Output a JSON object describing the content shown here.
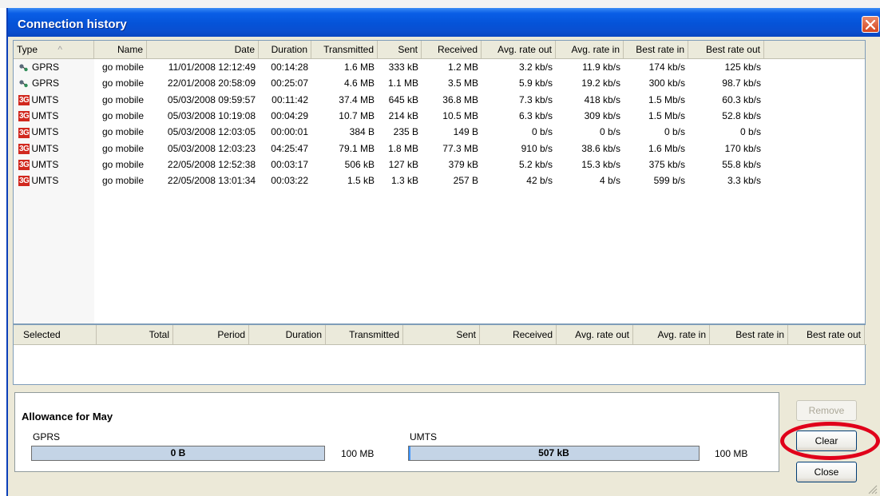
{
  "window": {
    "title": "Connection history"
  },
  "history": {
    "columns": [
      "Type",
      "Name",
      "Date",
      "Duration",
      "Transmitted",
      "Sent",
      "Received",
      "Avg. rate out",
      "Avg. rate in",
      "Best rate in",
      "Best rate out"
    ],
    "sort_indicator": "^",
    "rows": [
      {
        "type": "GPRS",
        "icon": "gprs-icon",
        "name": "go mobile",
        "date": "11/01/2008 12:12:49",
        "duration": "00:14:28",
        "transmitted": "1.6 MB",
        "sent": "333 kB",
        "received": "1.2 MB",
        "avg_out": "3.2 kb/s",
        "avg_in": "11.9 kb/s",
        "best_in": "174 kb/s",
        "best_out": "125 kb/s"
      },
      {
        "type": "GPRS",
        "icon": "gprs-icon",
        "name": "go mobile",
        "date": "22/01/2008 20:58:09",
        "duration": "00:25:07",
        "transmitted": "4.6 MB",
        "sent": "1.1 MB",
        "received": "3.5 MB",
        "avg_out": "5.9 kb/s",
        "avg_in": "19.2 kb/s",
        "best_in": "300 kb/s",
        "best_out": "98.7 kb/s"
      },
      {
        "type": "UMTS",
        "icon": "3g-icon",
        "name": "go mobile",
        "date": "05/03/2008 09:59:57",
        "duration": "00:11:42",
        "transmitted": "37.4 MB",
        "sent": "645 kB",
        "received": "36.8 MB",
        "avg_out": "7.3 kb/s",
        "avg_in": "418 kb/s",
        "best_in": "1.5 Mb/s",
        "best_out": "60.3 kb/s"
      },
      {
        "type": "UMTS",
        "icon": "3g-icon",
        "name": "go mobile",
        "date": "05/03/2008 10:19:08",
        "duration": "00:04:29",
        "transmitted": "10.7 MB",
        "sent": "214 kB",
        "received": "10.5 MB",
        "avg_out": "6.3 kb/s",
        "avg_in": "309 kb/s",
        "best_in": "1.5 Mb/s",
        "best_out": "52.8 kb/s"
      },
      {
        "type": "UMTS",
        "icon": "3g-icon",
        "name": "go mobile",
        "date": "05/03/2008 12:03:05",
        "duration": "00:00:01",
        "transmitted": "384 B",
        "sent": "235 B",
        "received": "149 B",
        "avg_out": "0 b/s",
        "avg_in": "0 b/s",
        "best_in": "0 b/s",
        "best_out": "0 b/s"
      },
      {
        "type": "UMTS",
        "icon": "3g-icon",
        "name": "go mobile",
        "date": "05/03/2008 12:03:23",
        "duration": "04:25:47",
        "transmitted": "79.1 MB",
        "sent": "1.8 MB",
        "received": "77.3 MB",
        "avg_out": "910 b/s",
        "avg_in": "38.6 kb/s",
        "best_in": "1.6 Mb/s",
        "best_out": "170 kb/s"
      },
      {
        "type": "UMTS",
        "icon": "3g-icon",
        "name": "go mobile",
        "date": "22/05/2008 12:52:38",
        "duration": "00:03:17",
        "transmitted": "506 kB",
        "sent": "127 kB",
        "received": "379 kB",
        "avg_out": "5.2 kb/s",
        "avg_in": "15.3 kb/s",
        "best_in": "375 kb/s",
        "best_out": "55.8 kb/s"
      },
      {
        "type": "UMTS",
        "icon": "3g-icon",
        "name": "go mobile",
        "date": "22/05/2008 13:01:34",
        "duration": "00:03:22",
        "transmitted": "1.5 kB",
        "sent": "1.3 kB",
        "received": "257 B",
        "avg_out": "42 b/s",
        "avg_in": "4 b/s",
        "best_in": "599 b/s",
        "best_out": "3.3 kb/s"
      }
    ]
  },
  "selection_summary": {
    "columns": [
      "Selected",
      "Total",
      "Period",
      "Duration",
      "Transmitted",
      "Sent",
      "Received",
      "Avg. rate out",
      "Avg. rate in",
      "Best rate in",
      "Best rate out"
    ]
  },
  "allowance": {
    "title": "Allowance for May",
    "gprs": {
      "label": "GPRS",
      "used": "0 B",
      "used_fraction": 0.0,
      "limit": "100 MB"
    },
    "umts": {
      "label": "UMTS",
      "used": "507 kB",
      "used_fraction": 0.005,
      "limit": "100 MB"
    }
  },
  "buttons": {
    "remove": "Remove",
    "clear": "Clear",
    "close": "Close"
  },
  "colors": {
    "title_bar": "#0553d8",
    "highlight_ring": "#e0001a",
    "icon_3g": "#d1281f"
  }
}
